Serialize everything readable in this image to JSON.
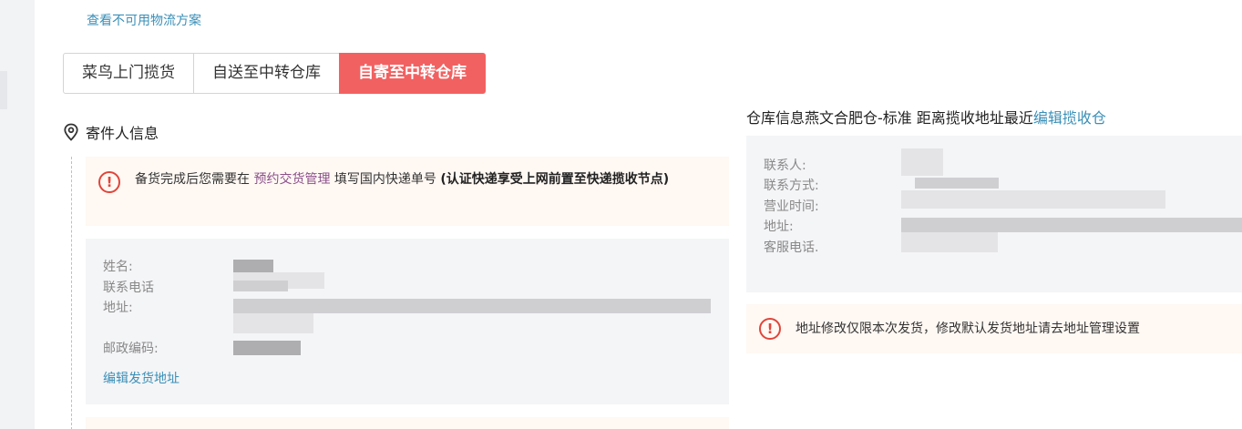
{
  "top_link": "查看不可用物流方案",
  "tabs": [
    {
      "label": "菜鸟上门揽货",
      "active": false
    },
    {
      "label": "自送至中转仓库",
      "active": false
    },
    {
      "label": "自寄至中转仓库",
      "active": true
    }
  ],
  "sender": {
    "title": "寄件人信息",
    "notice": {
      "prefix": "备货完成后您需要在",
      "link": "预约交货管理",
      "middle": "填写国内快递单号",
      "bold": "(认证快递享受上网前置至快递揽收节点)"
    },
    "labels": {
      "name": "姓名:",
      "phone": "联系电话",
      "address": "地址:",
      "postcode": "邮政编码:"
    },
    "edit_link": "编辑发货地址"
  },
  "warehouse": {
    "title_text": "仓库信息燕文合肥仓-标准 距离揽收地址最近",
    "edit_link": "编辑揽收仓",
    "labels": {
      "contact": "联系人:",
      "method": "联系方式:",
      "hours": "营业时间:",
      "address": "地址:",
      "service_phone": "客服电话."
    },
    "notice": "地址修改仅限本次发货，修改默认发货地址请去地址管理设置"
  },
  "colors": {
    "accent_red": "#f26161",
    "link_blue": "#3a8fb7",
    "warn_red": "#e0453a",
    "notice_bg": "#fff8f3",
    "panel_bg": "#f4f5f7"
  },
  "icons": {
    "location": "location-pin-icon",
    "warning": "exclamation-circle-icon"
  }
}
